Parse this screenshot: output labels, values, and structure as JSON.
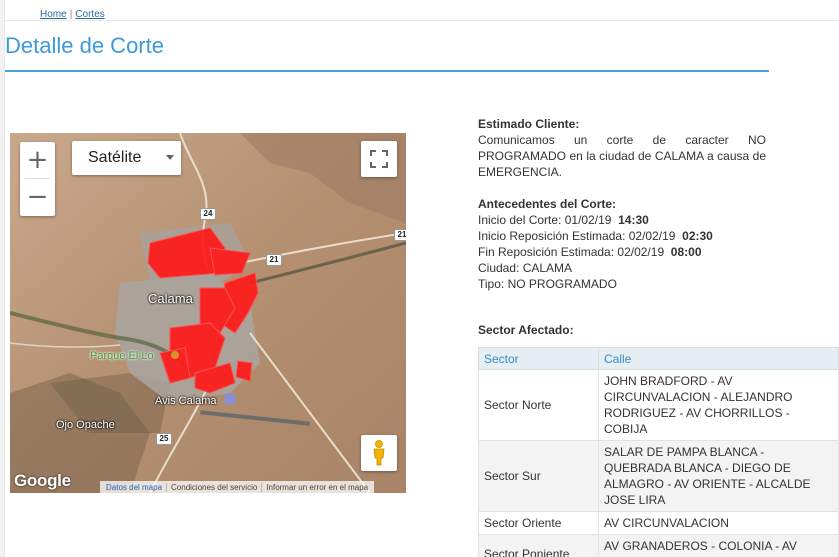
{
  "breadcrumb": {
    "home": "Home",
    "separator": "|",
    "current": "Cortes"
  },
  "page_title": "Detalle de Corte",
  "map": {
    "map_type": "Satélite",
    "zoom_in": "+",
    "zoom_out": "−",
    "labels": {
      "city": "Calama",
      "park": "Parque El Lo",
      "airport": "Avis Calama",
      "ojo": "Ojo Opache"
    },
    "route_shields": [
      "24",
      "21",
      "21",
      "25"
    ],
    "google": "Google",
    "footer": [
      "Datos del mapa",
      "Condiciones del servicio",
      "Informar un error en el mapa"
    ],
    "icons": {
      "fullscreen": "fullscreen-icon",
      "pegman": "pegman-icon",
      "caret": "chevron-down-icon"
    }
  },
  "cliente": {
    "heading": "Estimado Cliente:",
    "message": "Comunicamos un corte de caracter NO PROGRAMADO en la ciudad de CALAMA a causa de EMERGENCIA."
  },
  "antecedentes": {
    "heading": "Antecedentes del Corte:",
    "inicio_label": "Inicio del Corte: ",
    "inicio_date": "01/02/19",
    "inicio_time": "14:30",
    "reposicion_label": "Inicio Reposición Estimada: ",
    "reposicion_date": "02/02/19",
    "reposicion_time": "02:30",
    "fin_label": "Fin Reposición Estimada: ",
    "fin_date": "02/02/19",
    "fin_time": "08:00",
    "ciudad": "Ciudad: CALAMA",
    "tipo": "Tipo: NO PROGRAMADO"
  },
  "sector_afectado": {
    "heading": "Sector Afectado:",
    "columns": [
      "Sector",
      "Calle"
    ],
    "rows": [
      {
        "sector": "Sector Norte",
        "calle": "JOHN BRADFORD - AV CIRCUNVALACION - ALEJANDRO RODRIGUEZ - AV CHORRILLOS - COBIJA"
      },
      {
        "sector": "Sector Sur",
        "calle": "SALAR DE PAMPA BLANCA - QUEBRADA BLANCA - DIEGO DE ALMAGRO - AV ORIENTE - ALCALDE JOSE LIRA"
      },
      {
        "sector": "Sector Oriente",
        "calle": "AV CIRCUNVALACION"
      },
      {
        "sector": "Sector Poniente",
        "calle": "AV GRANADEROS - COLONIA - AV BALMACEDA - PEDRO DE VALDIVIA"
      }
    ]
  },
  "colors": {
    "title": "#3c9bd6",
    "rule": "#4aa3dd",
    "outage": "#ff1a1a",
    "table_header_bg": "#e5eef3"
  }
}
